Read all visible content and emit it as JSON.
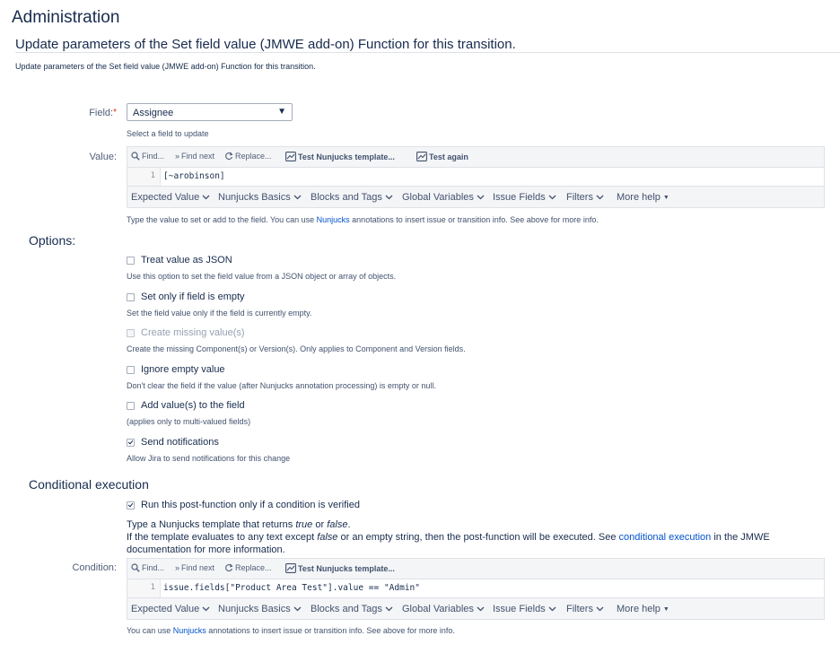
{
  "header": {
    "title": "Administration",
    "page_heading": "Update parameters of the Set field value (JMWE add-on) Function for this transition.",
    "page_description": "Update parameters of the Set field value (JMWE add-on) Function for this transition."
  },
  "field": {
    "label": "Field:",
    "required_mark": "*",
    "selected": "Assignee",
    "help": "Select a field to update"
  },
  "value": {
    "label": "Value:",
    "toolbar": {
      "find": "Find...",
      "find_next": "Find next",
      "replace": "Replace...",
      "test_template": "Test Nunjucks template...",
      "test_again": "Test again"
    },
    "line_number": "1",
    "code": "[~arobinson]",
    "help_prefix": "Type the value to set or add to the field. You can use ",
    "help_link": "Nunjucks",
    "help_suffix": " annotations to insert issue or transition info. See above for more info."
  },
  "editor_menu": {
    "items": [
      "Expected Value",
      "Nunjucks Basics",
      "Blocks and Tags",
      "Global Variables",
      "Issue Fields",
      "Filters",
      "More help"
    ]
  },
  "options": {
    "title": "Options:",
    "items": [
      {
        "label": "Treat value as JSON",
        "checked": false,
        "disabled": false,
        "help": "Use this option to set the field value from a JSON object or array of objects."
      },
      {
        "label": "Set only if field is empty",
        "checked": false,
        "disabled": false,
        "help": "Set the field value only if the field is currently empty."
      },
      {
        "label": "Create missing value(s)",
        "checked": false,
        "disabled": true,
        "help": "Create the missing Component(s) or Version(s). Only applies to Component and Version fields."
      },
      {
        "label": "Ignore empty value",
        "checked": false,
        "disabled": false,
        "help": "Don't clear the field if the value (after Nunjucks annotation processing) is empty or null."
      },
      {
        "label": "Add value(s) to the field",
        "checked": false,
        "disabled": false,
        "help": "(applies only to multi-valued fields)"
      },
      {
        "label": "Send notifications",
        "checked": true,
        "disabled": false,
        "help": "Allow Jira to send notifications for this change"
      }
    ]
  },
  "conditional": {
    "title": "Conditional execution",
    "checkbox_label": "Run this post-function only if a condition is verified",
    "checked": true,
    "text1_a": "Type a Nunjucks template that returns ",
    "text1_true": "true",
    "text1_or": " or ",
    "text1_false": "false",
    "text1_end": ".",
    "text2_a": "If the template evaluates to any text except ",
    "text2_false": "false",
    "text2_b": " or an empty string, then the post-function will be executed. See ",
    "text2_link": "conditional execution",
    "text2_c": " in the JMWE documentation for more information.",
    "condition_label": "Condition:",
    "toolbar": {
      "find": "Find...",
      "find_next": "Find next",
      "replace": "Replace...",
      "test_template": "Test Nunjucks template..."
    },
    "line_number": "1",
    "code": "issue.fields[\"Product Area Test\"].value == \"Admin\"",
    "help_prefix": "You can use ",
    "help_link": "Nunjucks",
    "help_suffix": " annotations to insert issue or transition info. See above for more info."
  },
  "colors": {
    "link": "#0052cc",
    "required": "#de350b",
    "text": "#172b4d"
  }
}
